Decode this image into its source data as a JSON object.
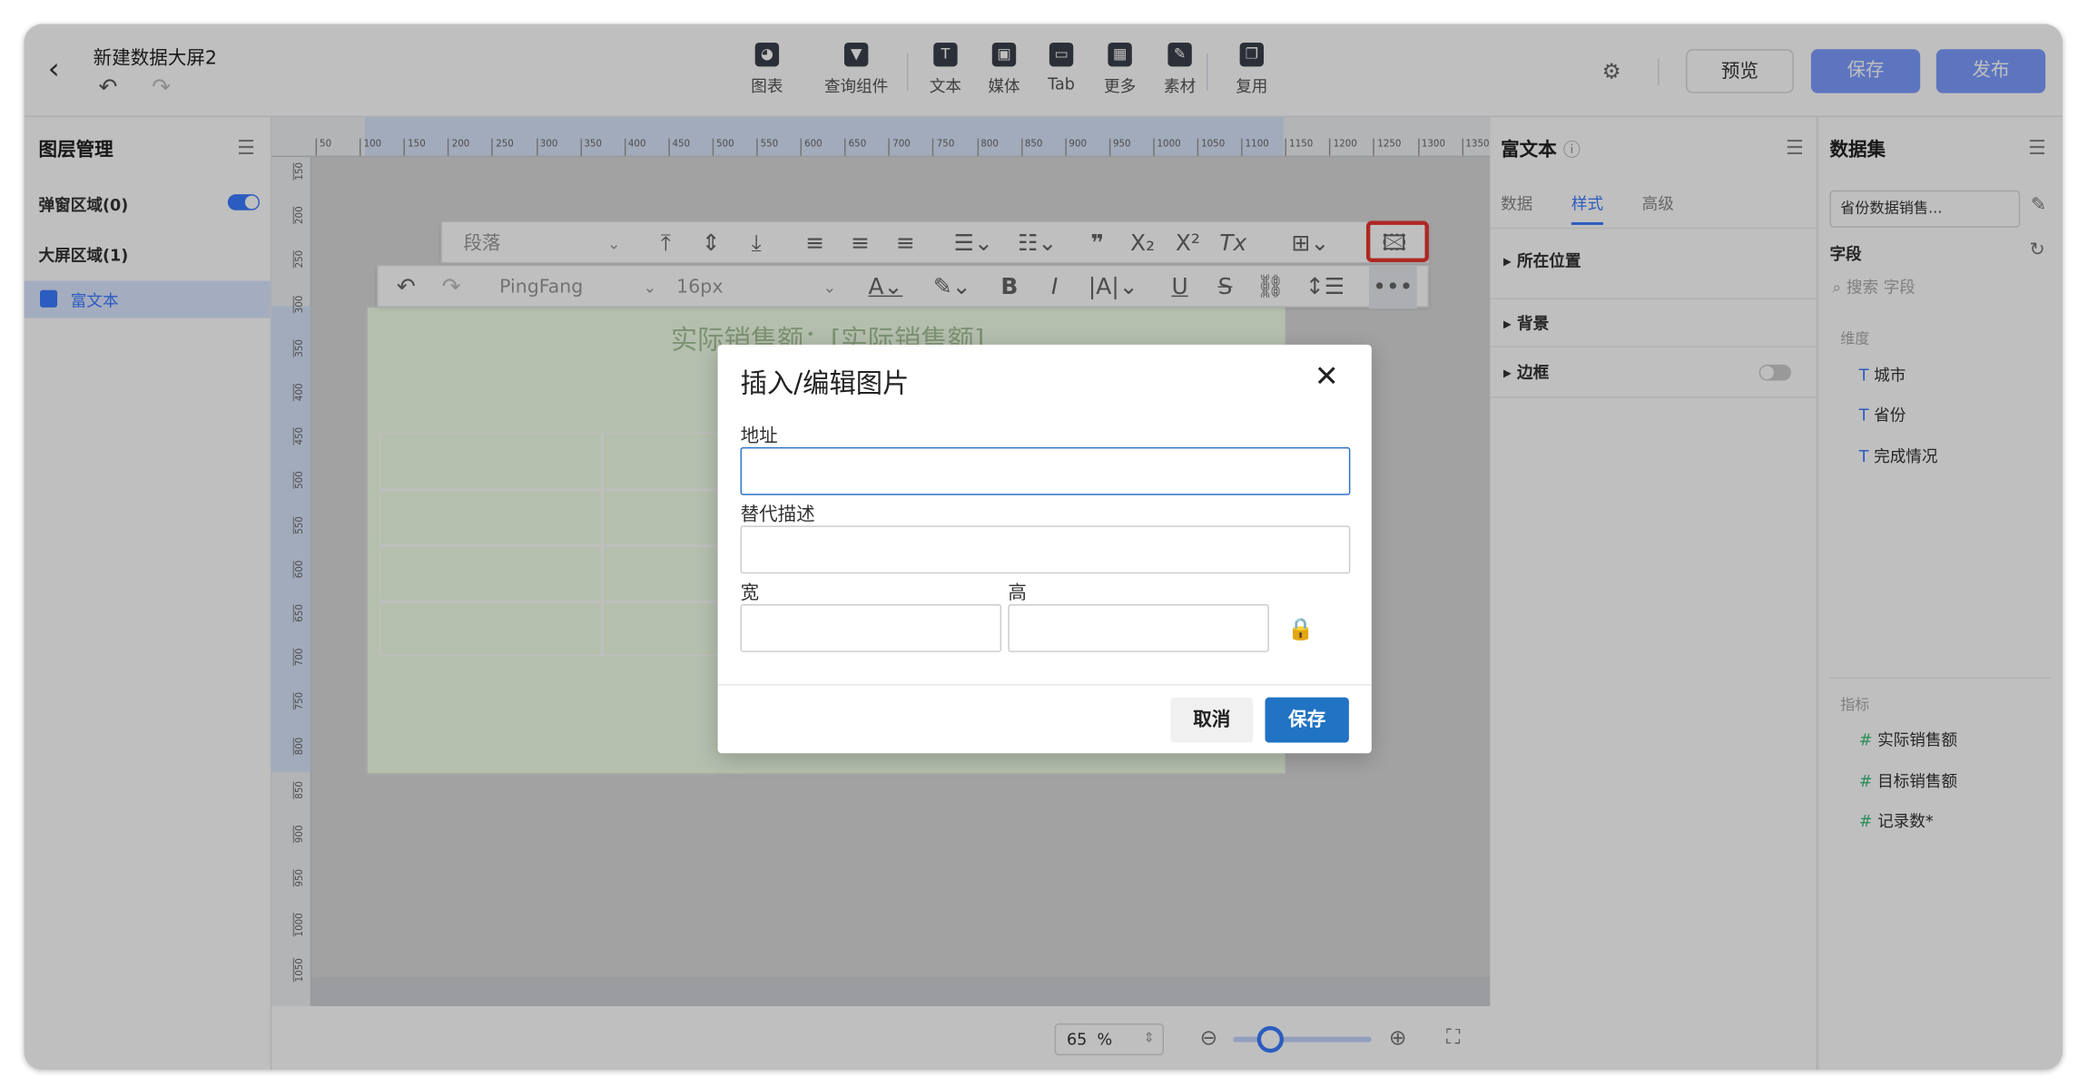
{
  "header": {
    "title": "新建数据大屏2",
    "preview": "预览",
    "save": "保存",
    "publish": "发布"
  },
  "toolbar": [
    {
      "label": "图表",
      "icon": "◕"
    },
    {
      "label": "查询组件",
      "icon": "▼"
    },
    {
      "label": "文本",
      "icon": "T"
    },
    {
      "label": "媒体",
      "icon": "▣"
    },
    {
      "label": "Tab",
      "icon": "▭"
    },
    {
      "label": "更多",
      "icon": "▦"
    },
    {
      "label": "素材",
      "icon": "✎"
    },
    {
      "label": "复用",
      "icon": "❐"
    }
  ],
  "left_panel": {
    "title": "图层管理",
    "popup_area": "弹窗区域(0)",
    "screen_area": "大屏区域(1)",
    "layer_item": "富文本"
  },
  "canvas": {
    "element_title": "实际销售额：[实际销售额]",
    "ruler_h": [
      "50",
      "100",
      "150",
      "200",
      "250",
      "300",
      "350",
      "400",
      "450",
      "500",
      "550",
      "600",
      "650",
      "700",
      "750",
      "800",
      "850",
      "900",
      "950",
      "1000",
      "1050",
      "1100",
      "1150",
      "1200",
      "1250",
      "1300",
      "1350"
    ],
    "ruler_v": [
      "150",
      "200",
      "250",
      "300",
      "350",
      "400",
      "450",
      "500",
      "550",
      "600",
      "650",
      "700",
      "750",
      "800",
      "850",
      "900",
      "950",
      "1000",
      "1050"
    ],
    "zoom": "65",
    "zoom_unit": "%"
  },
  "editor": {
    "paragraph": "段落",
    "font": "PingFang",
    "size": "16px"
  },
  "dialog": {
    "title": "插入/编辑图片",
    "address_label": "地址",
    "alt_label": "替代描述",
    "width_label": "宽",
    "height_label": "高",
    "cancel": "取消",
    "save": "保存"
  },
  "right_panel": {
    "title": "富文本",
    "tabs": [
      "数据",
      "样式",
      "高级"
    ],
    "sections": [
      "所在位置",
      "背景",
      "边框"
    ]
  },
  "dataset_panel": {
    "title": "数据集",
    "dataset": "省份数据销售...",
    "fields_title": "字段",
    "search_placeholder": "搜索 字段",
    "dim_title": "维度",
    "dims": [
      "城市",
      "省份",
      "完成情况"
    ],
    "metric_title": "指标",
    "metrics": [
      "实际销售额",
      "目标销售额",
      "记录数*"
    ]
  }
}
